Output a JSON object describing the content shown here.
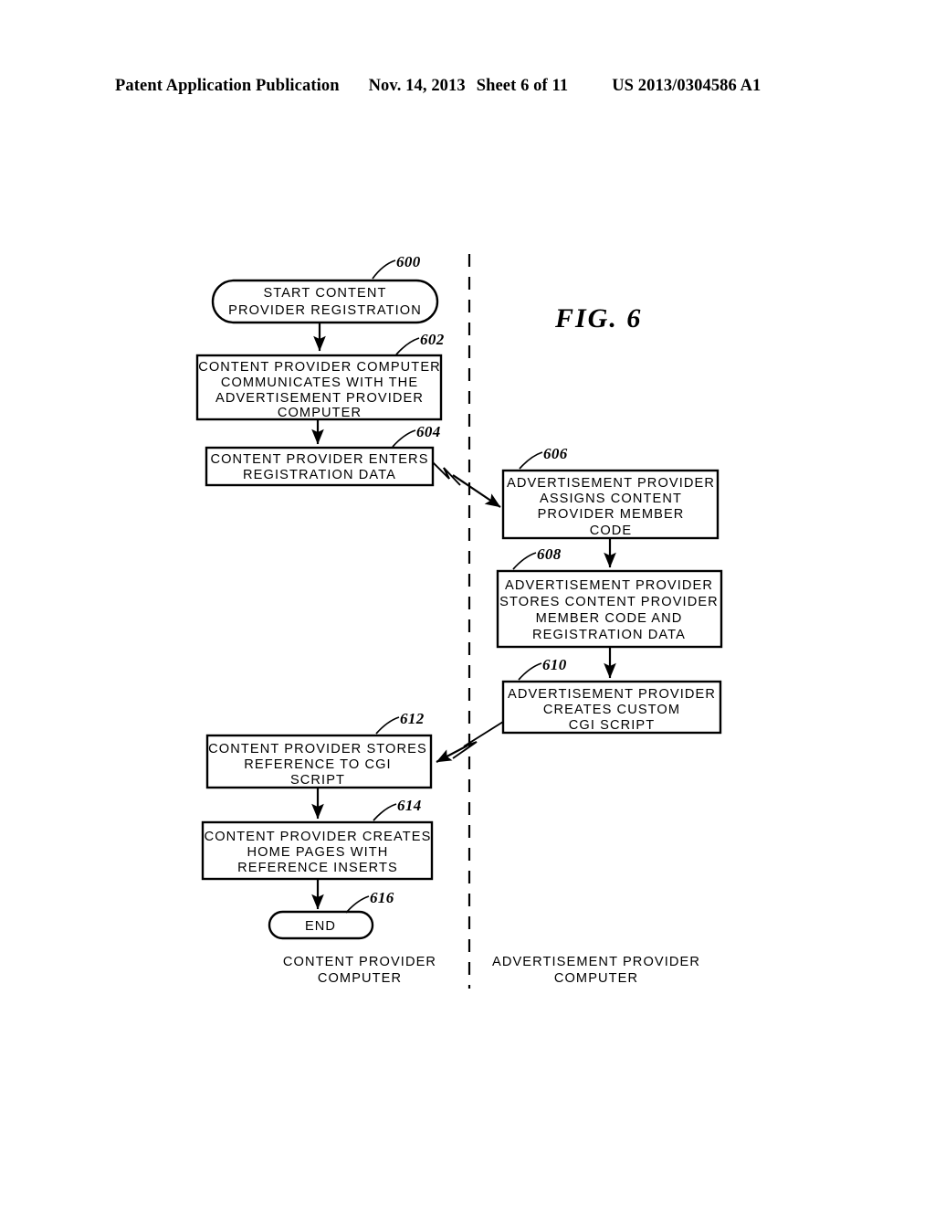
{
  "header": {
    "publication": "Patent Application Publication",
    "date": "Nov. 14, 2013",
    "sheet": "Sheet 6 of 11",
    "patent_number": "US 2013/0304586 A1"
  },
  "figure": {
    "label": "FIG. 6",
    "column_labels": {
      "left": [
        "CONTENT PROVIDER",
        "COMPUTER"
      ],
      "right": [
        "ADVERTISEMENT PROVIDER",
        "COMPUTER"
      ]
    },
    "nodes": [
      {
        "ref": "600",
        "shape": "terminator",
        "column": "left",
        "lines": [
          "START CONTENT",
          "PROVIDER REGISTRATION"
        ]
      },
      {
        "ref": "602",
        "shape": "process",
        "column": "left",
        "lines": [
          "CONTENT PROVIDER COMPUTER",
          "COMMUNICATES WITH THE",
          "ADVERTISEMENT PROVIDER",
          "COMPUTER"
        ]
      },
      {
        "ref": "604",
        "shape": "process",
        "column": "left",
        "lines": [
          "CONTENT PROVIDER ENTERS",
          "REGISTRATION DATA"
        ]
      },
      {
        "ref": "606",
        "shape": "process",
        "column": "right",
        "lines": [
          "ADVERTISEMENT PROVIDER",
          "ASSIGNS CONTENT",
          "PROVIDER MEMBER",
          "CODE"
        ]
      },
      {
        "ref": "608",
        "shape": "process",
        "column": "right",
        "lines": [
          "ADVERTISEMENT PROVIDER",
          "STORES CONTENT PROVIDER",
          "MEMBER CODE AND",
          "REGISTRATION DATA"
        ]
      },
      {
        "ref": "610",
        "shape": "process",
        "column": "right",
        "lines": [
          "ADVERTISEMENT PROVIDER",
          "CREATES CUSTOM",
          "CGI SCRIPT"
        ]
      },
      {
        "ref": "612",
        "shape": "process",
        "column": "left",
        "lines": [
          "CONTENT PROVIDER STORES",
          "REFERENCE TO CGI",
          "SCRIPT"
        ]
      },
      {
        "ref": "614",
        "shape": "process",
        "column": "left",
        "lines": [
          "CONTENT PROVIDER CREATES",
          "HOME PAGES WITH",
          "REFERENCE INSERTS"
        ]
      },
      {
        "ref": "616",
        "shape": "terminator",
        "column": "left",
        "lines": [
          "END"
        ]
      }
    ]
  },
  "colors": {
    "ink": "#000000",
    "paper": "#ffffff"
  }
}
